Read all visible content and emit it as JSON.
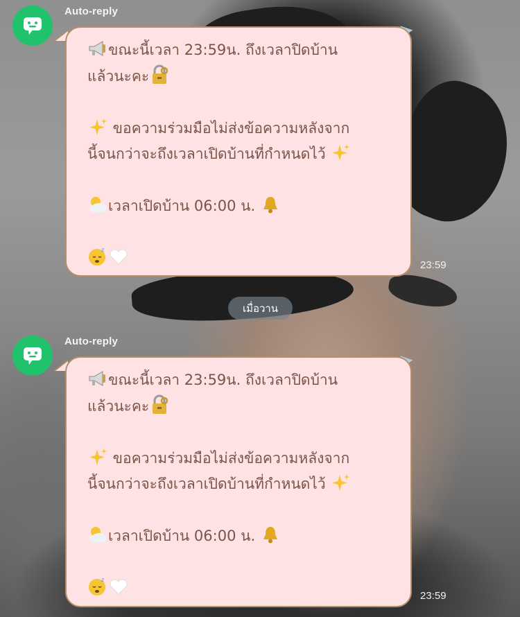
{
  "date_separator": "เมื่อวาน",
  "messages": [
    {
      "sender": "Auto-reply",
      "avatar_icon": "chat-bot-icon",
      "time": "23:59",
      "lines": {
        "l1": "ขณะนี้เวลา 23:59น. ถึงเวลาปิดบ้าน",
        "l2": "แล้วนะคะ",
        "l3": " ขอความร่วมมือไม่ส่งข้อความหลังจาก",
        "l4": "นี้จนกว่าจะถึงเวลาเปิดบ้านที่กำหนดไว้ ",
        "l5": "เวลาเปิดบ้าน 06:00 น. "
      },
      "emoji_icons": [
        "megaphone-icon",
        "locked-with-key-icon",
        "sparkles-icon",
        "sun-behind-cloud-icon",
        "bell-icon",
        "sleeping-face-icon",
        "white-heart-icon"
      ]
    },
    {
      "sender": "Auto-reply",
      "avatar_icon": "chat-bot-icon",
      "time": "23:59",
      "lines": {
        "l1": "ขณะนี้เวลา 23:59น. ถึงเวลาปิดบ้าน",
        "l2": "แล้วนะคะ",
        "l3": " ขอความร่วมมือไม่ส่งข้อความหลังจาก",
        "l4": "นี้จนกว่าจะถึงเวลาเปิดบ้านที่กำหนดไว้ ",
        "l5": "เวลาเปิดบ้าน 06:00 น. "
      },
      "emoji_icons": [
        "megaphone-icon",
        "locked-with-key-icon",
        "sparkles-icon",
        "sun-behind-cloud-icon",
        "bell-icon",
        "sleeping-face-icon",
        "white-heart-icon"
      ]
    }
  ],
  "colors": {
    "avatar_bg": "#20c36b",
    "bubble_bg": "#ffe2e4",
    "bubble_border": "#b48f6a",
    "bubble_text": "#7a5448",
    "date_pill_bg": "#78828c"
  }
}
